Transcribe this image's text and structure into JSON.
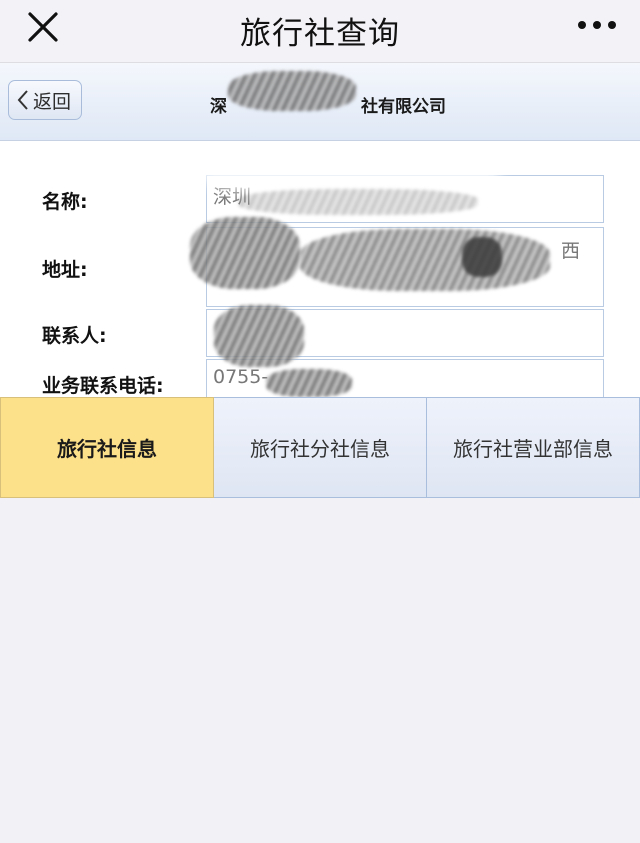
{
  "header": {
    "title": "旅行社查询",
    "close_icon": "close-icon",
    "more_icon": "more-icon"
  },
  "subheader": {
    "back_label": "返回",
    "back_icon": "chevron-left-icon",
    "company_name_prefix": "深",
    "company_name_suffix": "社有限公司"
  },
  "info": {
    "rows": [
      {
        "label": "名称:",
        "value": "深圳"
      },
      {
        "label": "地址:",
        "value": "西"
      },
      {
        "label": "联系人:",
        "value": ""
      },
      {
        "label": "业务联系电话:",
        "value": "0755-"
      }
    ]
  },
  "tabs": [
    {
      "label": "旅行社信息",
      "active": true
    },
    {
      "label": "旅行社分社信息",
      "active": false
    },
    {
      "label": "旅行社营业部信息",
      "active": false
    }
  ],
  "colors": {
    "active_tab": "#fde08a",
    "tab_border": "#a8bedc",
    "page_bg": "#f2f1f6"
  }
}
